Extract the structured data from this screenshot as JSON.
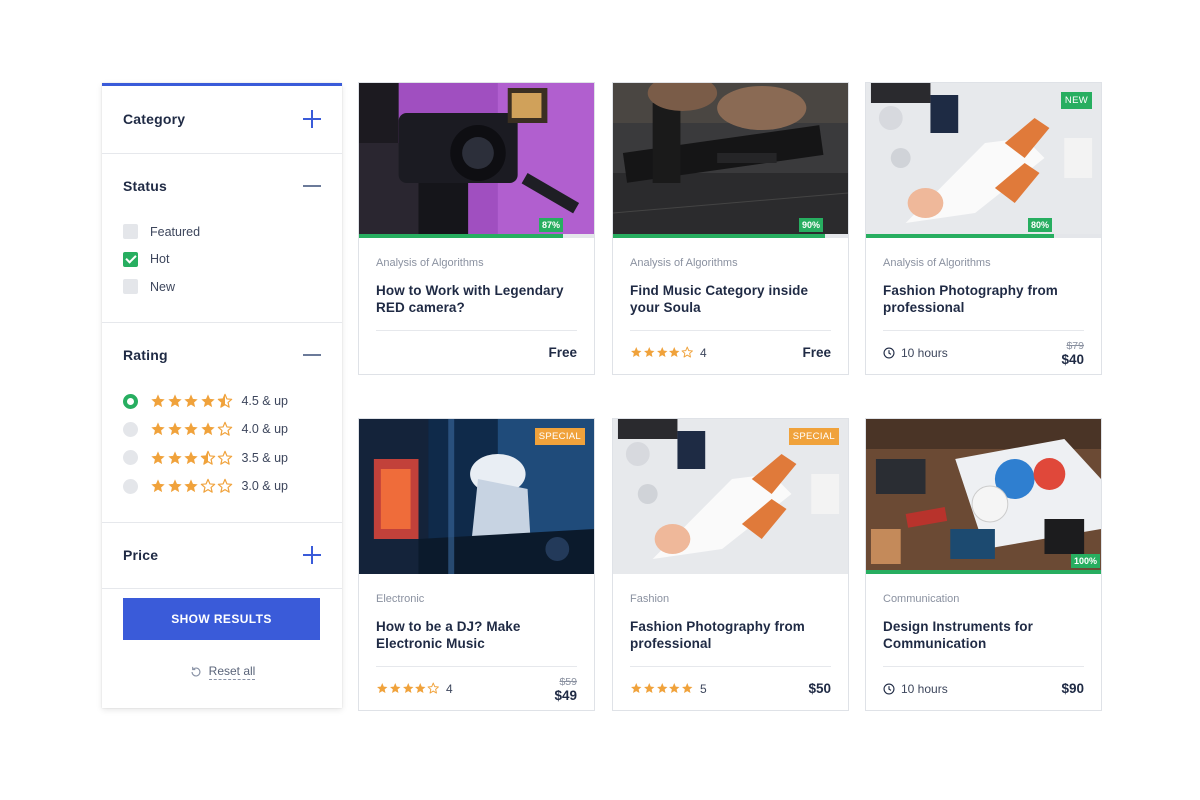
{
  "sidebar": {
    "category": {
      "title": "Category"
    },
    "status": {
      "title": "Status",
      "items": [
        {
          "label": "Featured",
          "checked": false
        },
        {
          "label": "Hot",
          "checked": true
        },
        {
          "label": "New",
          "checked": false
        }
      ]
    },
    "rating": {
      "title": "Rating",
      "items": [
        {
          "label": "4.5 & up",
          "stars": 4.5,
          "selected": true
        },
        {
          "label": "4.0 & up",
          "stars": 4.0,
          "selected": false
        },
        {
          "label": "3.5 & up",
          "stars": 3.5,
          "selected": false
        },
        {
          "label": "3.0 & up",
          "stars": 3.0,
          "selected": false
        }
      ]
    },
    "price": {
      "title": "Price"
    },
    "show_results_label": "SHOW RESULTS",
    "reset_label": "Reset all"
  },
  "colors": {
    "accent": "#3a5bd9",
    "success": "#27ae60",
    "star": "#f0a23b",
    "special": "#f0a23b"
  },
  "cards": [
    {
      "category": "Analysis of Algorithms",
      "title": "How to Work with Legendary RED camera?",
      "progress": "87%",
      "tag": "",
      "rating": null,
      "rating_count": "",
      "duration": "",
      "old_price": "",
      "price": "Free"
    },
    {
      "category": "Analysis of Algorithms",
      "title": "Find Music Category inside your Soula",
      "progress": "90%",
      "tag": "",
      "rating": 4,
      "rating_count": "4",
      "duration": "",
      "old_price": "",
      "price": "Free"
    },
    {
      "category": "Analysis of Algorithms",
      "title": "Fashion Photography from professional",
      "progress": "80%",
      "tag": "NEW",
      "rating": null,
      "rating_count": "",
      "duration": "10 hours",
      "old_price": "$79",
      "price": "$40"
    },
    {
      "category": "Electronic",
      "title": "How to be a DJ? Make Electronic Music",
      "progress": "",
      "tag": "SPECIAL",
      "rating": 4,
      "rating_count": "4",
      "duration": "",
      "old_price": "$59",
      "price": "$49"
    },
    {
      "category": "Fashion",
      "title": "Fashion Photography from professional",
      "progress": "",
      "tag": "SPECIAL",
      "rating": 5,
      "rating_count": "5",
      "duration": "",
      "old_price": "",
      "price": "$50"
    },
    {
      "category": "Communication",
      "title": "Design Instruments for Communication",
      "progress": "100%",
      "tag": "",
      "rating": null,
      "rating_count": "",
      "duration": "10 hours",
      "old_price": "",
      "price": "$90"
    }
  ]
}
